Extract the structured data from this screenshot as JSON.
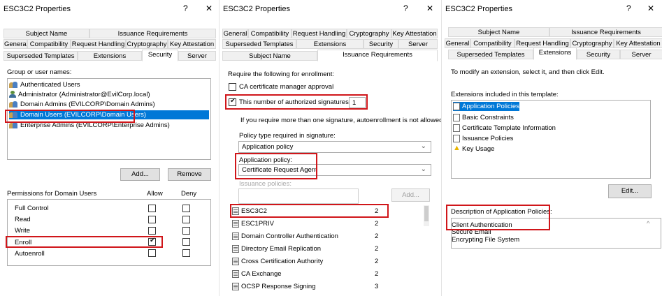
{
  "dialog1": {
    "title": "ESC3C2 Properties",
    "help": "?",
    "close": "✕",
    "tabs_row1": [
      "Subject Name",
      "Issuance Requirements"
    ],
    "tabs_row2": [
      "General",
      "Compatibility",
      "Request Handling",
      "Cryptography",
      "Key Attestation"
    ],
    "tabs_row3": [
      "Superseded Templates",
      "Extensions",
      "Security",
      "Server"
    ],
    "group_label": "Group or user names:",
    "principals": [
      "Authenticated Users",
      "Administrator (Administrator@EvilCorp.local)",
      "Domain Admins (EVILCORP\\Domain Admins)",
      "Domain Users (EVILCORP\\Domain Users)",
      "Enterprise Admins (EVILCORP\\Enterprise Admins)"
    ],
    "add_button": "Add...",
    "remove_button": "Remove",
    "permissions_label": "Permissions for Domain Users",
    "allow_label": "Allow",
    "deny_label": "Deny",
    "permissions": [
      {
        "name": "Full Control",
        "allow": false,
        "deny": false
      },
      {
        "name": "Read",
        "allow": false,
        "deny": false
      },
      {
        "name": "Write",
        "allow": false,
        "deny": false
      },
      {
        "name": "Enroll",
        "allow": true,
        "deny": false
      },
      {
        "name": "Autoenroll",
        "allow": false,
        "deny": false
      }
    ]
  },
  "dialog2": {
    "title": "ESC3C2 Properties",
    "help": "?",
    "close": "✕",
    "tabs_row1": [
      "General",
      "Compatibility",
      "Request Handling",
      "Cryptography",
      "Key Attestation"
    ],
    "tabs_row2": [
      "Superseded Templates",
      "Extensions",
      "Security",
      "Server"
    ],
    "tabs_row3": [
      "Subject Name",
      "Issuance Requirements"
    ],
    "require_label": "Require the following for enrollment:",
    "ca_approval": "CA certificate manager approval",
    "num_signatures_label": "This number of authorized signatures:",
    "num_signatures_value": "1",
    "info_text": "If you require more than one signature, autoenrollment is not allowed.",
    "policy_type_label": "Policy type required in signature:",
    "policy_type_value": "Application policy",
    "app_policy_label": "Application policy:",
    "app_policy_value": "Certificate Request Agent",
    "issuance_label": "Issuance policies:",
    "add_button": "Add...",
    "templates": [
      {
        "name": "ESC3C2",
        "value": "2"
      },
      {
        "name": "ESC1PRIV",
        "value": "2"
      },
      {
        "name": "Domain Controller Authentication",
        "value": "2"
      },
      {
        "name": "Directory Email Replication",
        "value": "2"
      },
      {
        "name": "Cross Certification Authority",
        "value": "2"
      },
      {
        "name": "CA Exchange",
        "value": "2"
      },
      {
        "name": "OCSP Response Signing",
        "value": "3"
      }
    ]
  },
  "dialog3": {
    "title": "ESC3C2 Properties",
    "help": "?",
    "close": "✕",
    "tabs_row1": [
      "Subject Name",
      "Issuance Requirements"
    ],
    "tabs_row2": [
      "General",
      "Compatibility",
      "Request Handling",
      "Cryptography",
      "Key Attestation"
    ],
    "tabs_row3": [
      "Superseded Templates",
      "Extensions",
      "Security",
      "Server"
    ],
    "instructions": "To modify an extension, select it, and then click Edit.",
    "extensions_label": "Extensions included in this template:",
    "extensions": [
      "Application Policies",
      "Basic Constraints",
      "Certificate Template Information",
      "Issuance Policies",
      "Key Usage"
    ],
    "edit_button": "Edit...",
    "description_label": "Description of Application Policies:",
    "description_lines": [
      "Client Authentication",
      "Secure Email",
      "Encrypting File System"
    ]
  },
  "colors": {
    "highlight": "#d0161a",
    "selection": "#0078d7"
  }
}
